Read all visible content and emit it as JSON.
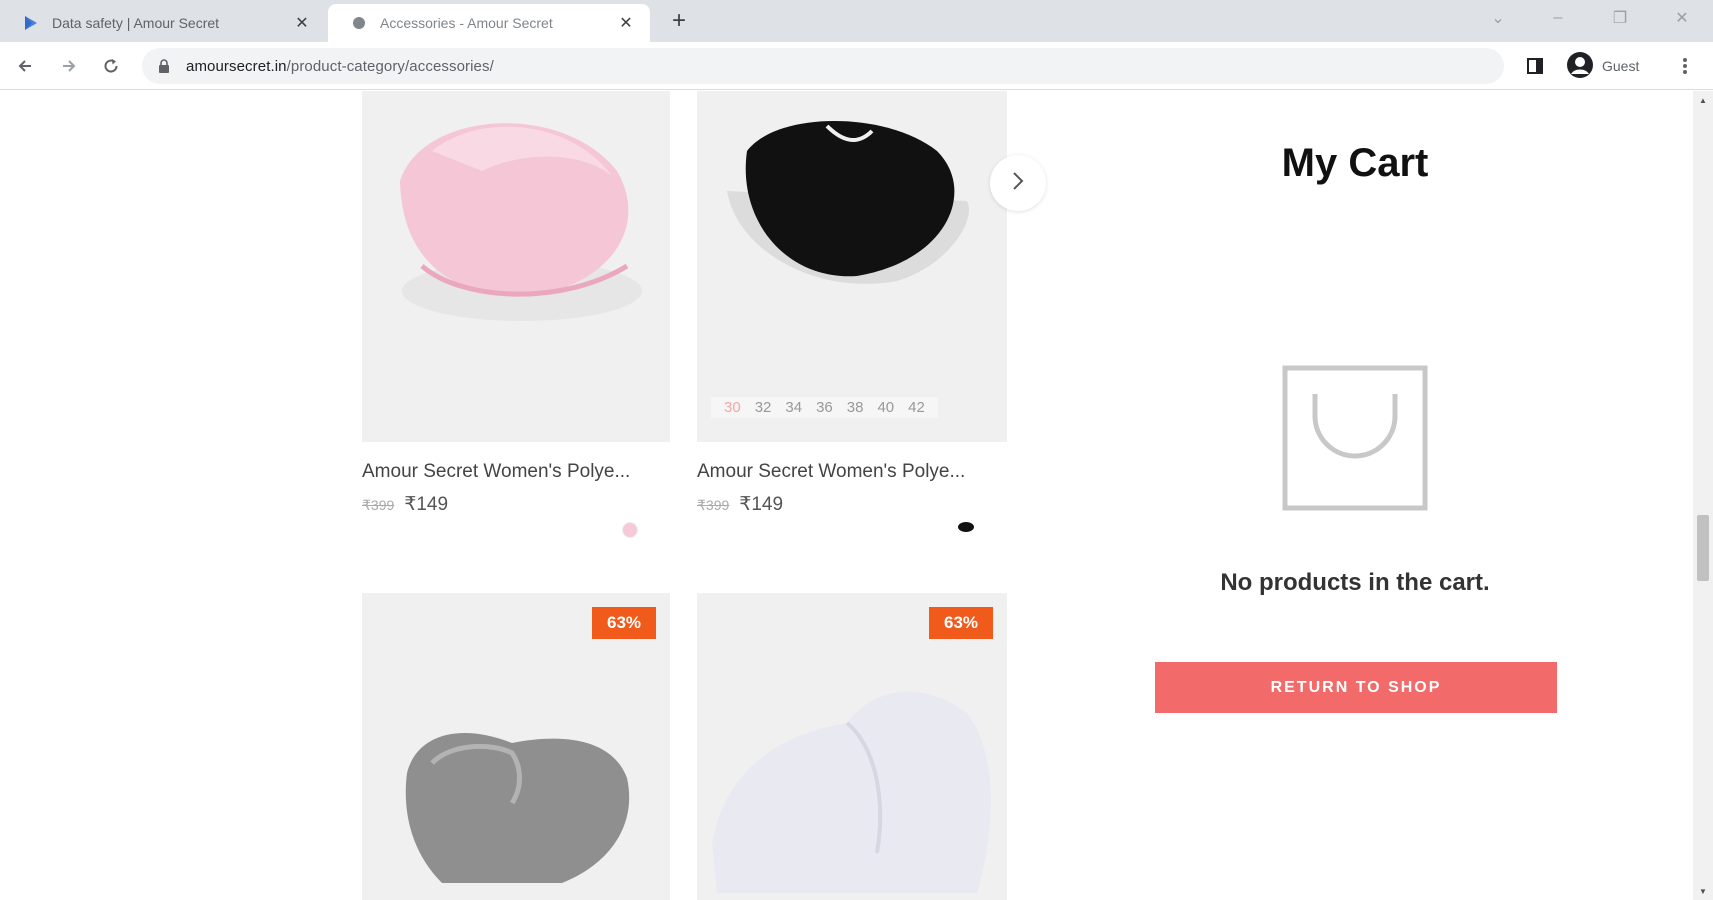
{
  "browser": {
    "tabs": [
      {
        "title": "Data safety | Amour Secret",
        "active": false
      },
      {
        "title": "Accessories - Amour Secret",
        "active": true
      }
    ],
    "url_host": "amoursecret.in",
    "url_path": "/product-category/accessories/",
    "profile_label": "Guest"
  },
  "products": [
    {
      "name": "Amour Secret Women's Polye...",
      "old_price": "₹399",
      "price": "₹149",
      "swatch_color": "#f6c9d8",
      "color": "pink"
    },
    {
      "name": "Amour Secret Women's Polye...",
      "old_price": "₹399",
      "price": "₹149",
      "swatch_color": "#111111",
      "color": "black",
      "sizes": [
        "30",
        "32",
        "34",
        "36",
        "38",
        "40",
        "42"
      ]
    },
    {
      "badge": "63%",
      "color": "grey"
    },
    {
      "badge": "63%",
      "color": "white"
    }
  ],
  "cart": {
    "title": "My Cart",
    "empty_message": "No products in the cart.",
    "return_button": "RETURN TO SHOP"
  },
  "colors": {
    "accent": "#f26a6a",
    "badge": "#f05a1a"
  }
}
